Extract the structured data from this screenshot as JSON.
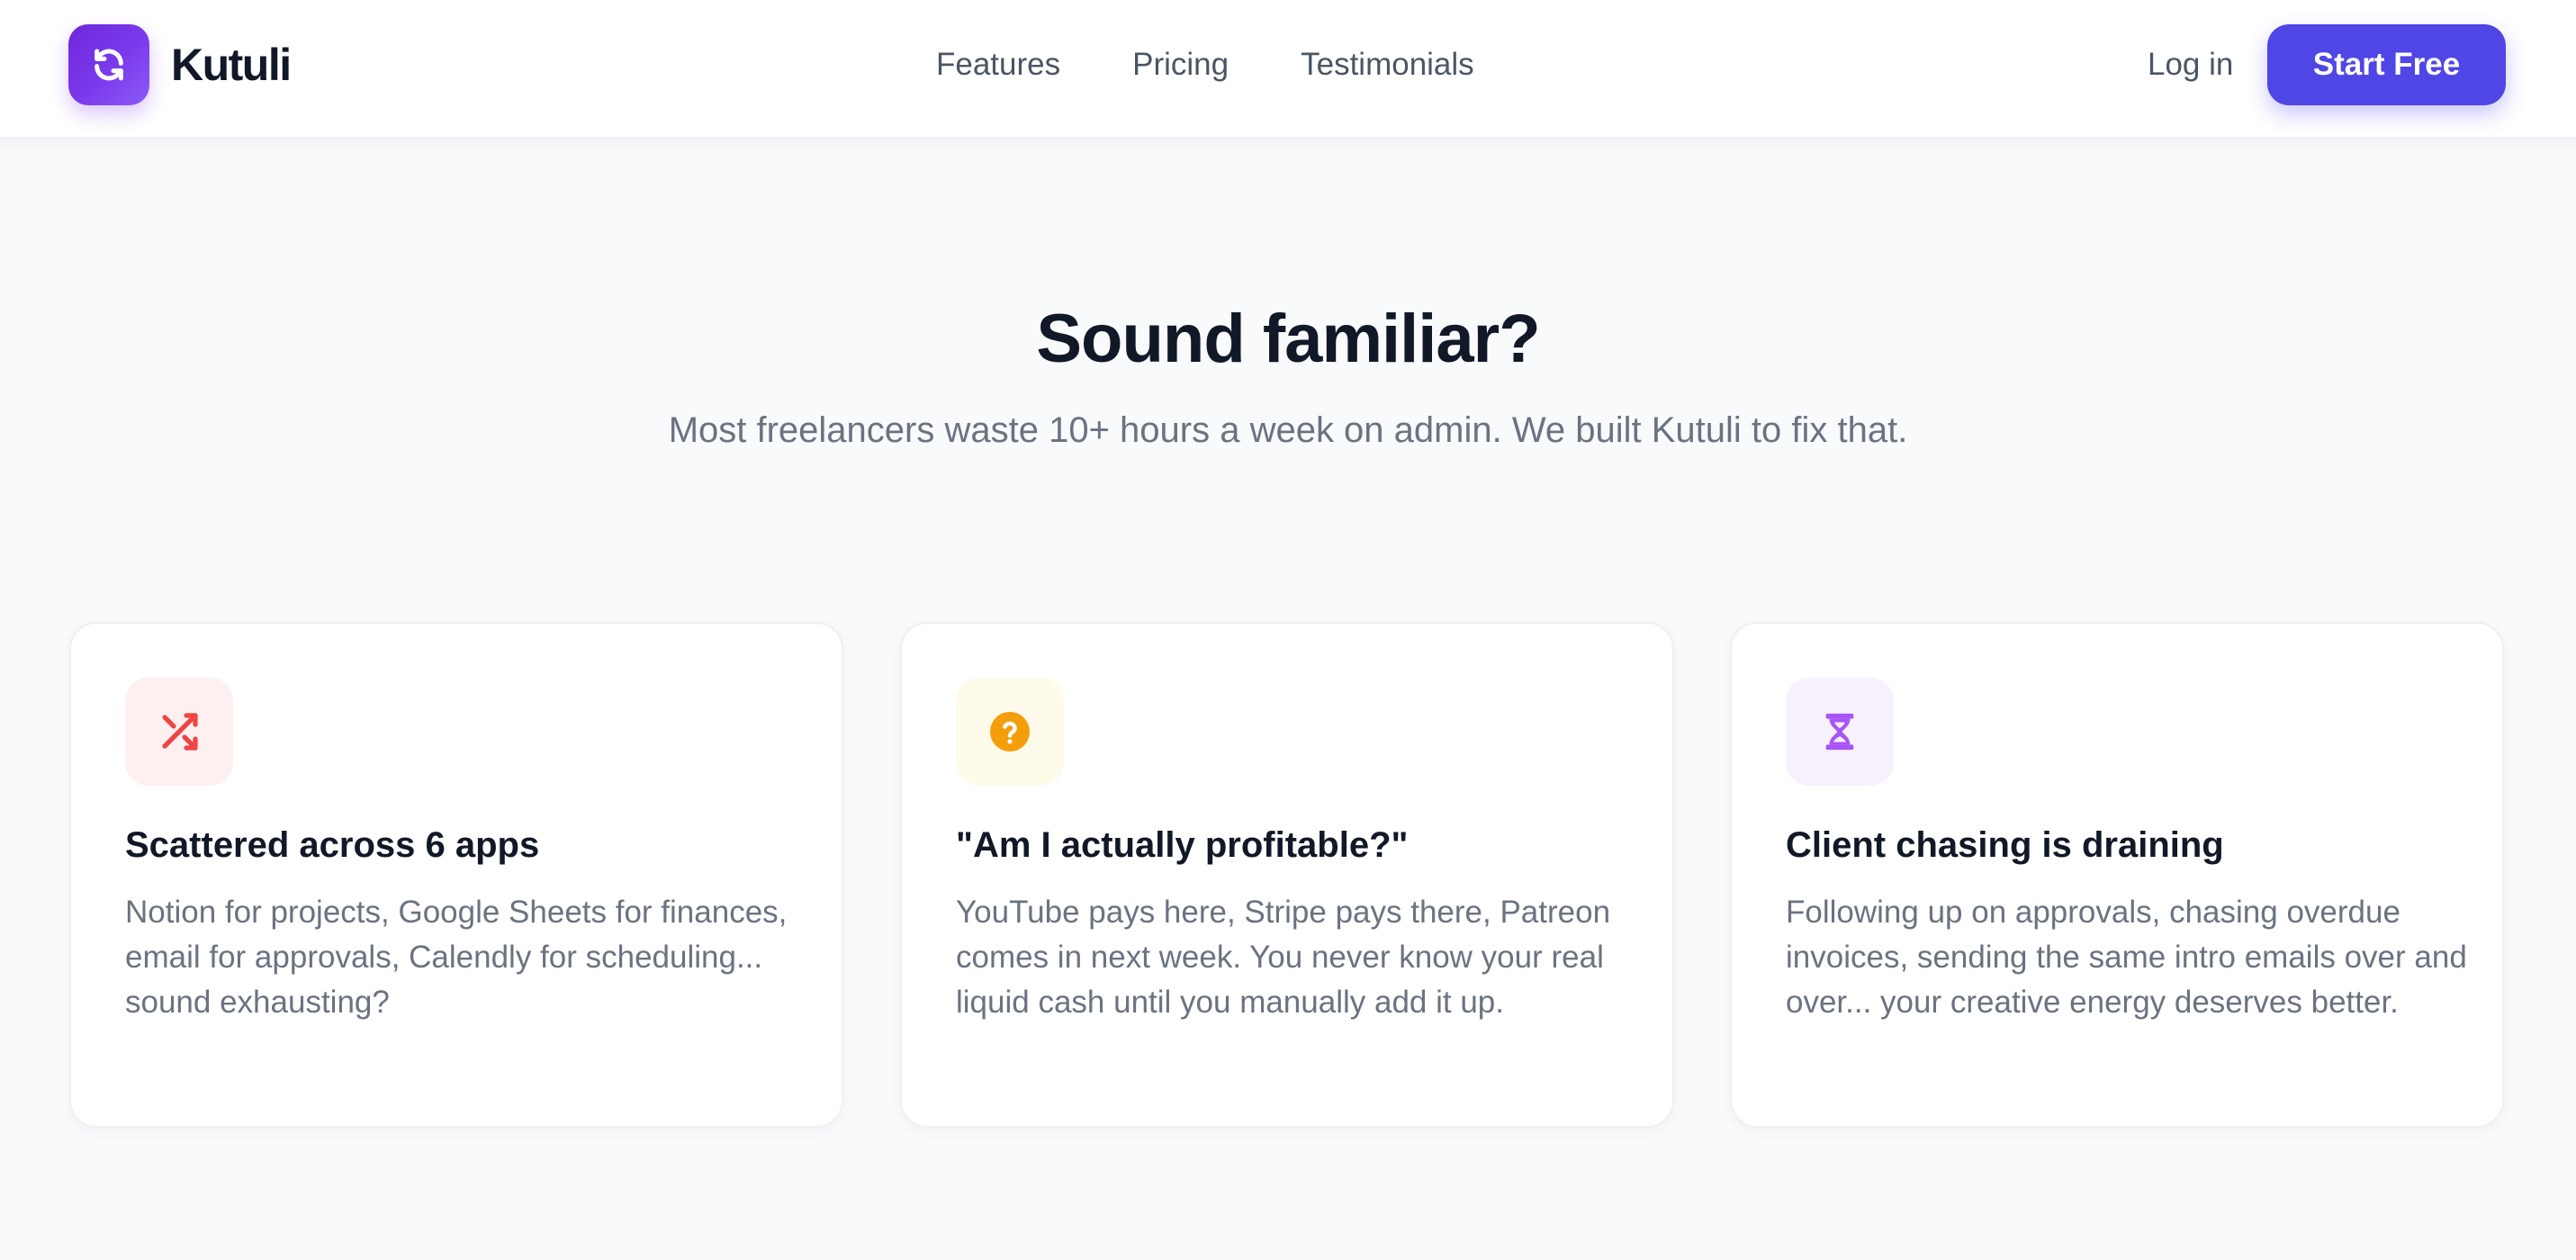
{
  "header": {
    "brand": {
      "name": "Kutuli",
      "logo_icon": "refresh-icon",
      "logo_gradient": [
        "#6d28d9",
        "#8b5cf6"
      ]
    },
    "nav": [
      {
        "label": "Features"
      },
      {
        "label": "Pricing"
      },
      {
        "label": "Testimonials"
      }
    ],
    "login_label": "Log in",
    "cta_label": "Start Free",
    "cta_color": "#4f46e5"
  },
  "section": {
    "title": "Sound familiar?",
    "subtitle": "Most freelancers waste 10+ hours a week on admin. We built Kutuli to fix that."
  },
  "cards": [
    {
      "icon": "shuffle-icon",
      "icon_color": "#ef4444",
      "icon_bg": "#fef0f0",
      "title": "Scattered across 6 apps",
      "text": "Notion for projects, Google Sheets for finances, email for approvals, Calendly for scheduling... sound exhausting?"
    },
    {
      "icon": "question-circle-icon",
      "icon_color": "#f59e0b",
      "icon_bg": "#fffbea",
      "title": "\"Am I actually profitable?\"",
      "text": "YouTube pays here, Stripe pays there, Patreon comes in next week. You never know your real liquid cash until you manually add it up."
    },
    {
      "icon": "hourglass-icon",
      "icon_color": "#a855f7",
      "icon_bg": "#f7f1fe",
      "title": "Client chasing is draining",
      "text": "Following up on approvals, chasing overdue invoices, sending the same intro emails over and over... your creative energy deserves better."
    }
  ]
}
